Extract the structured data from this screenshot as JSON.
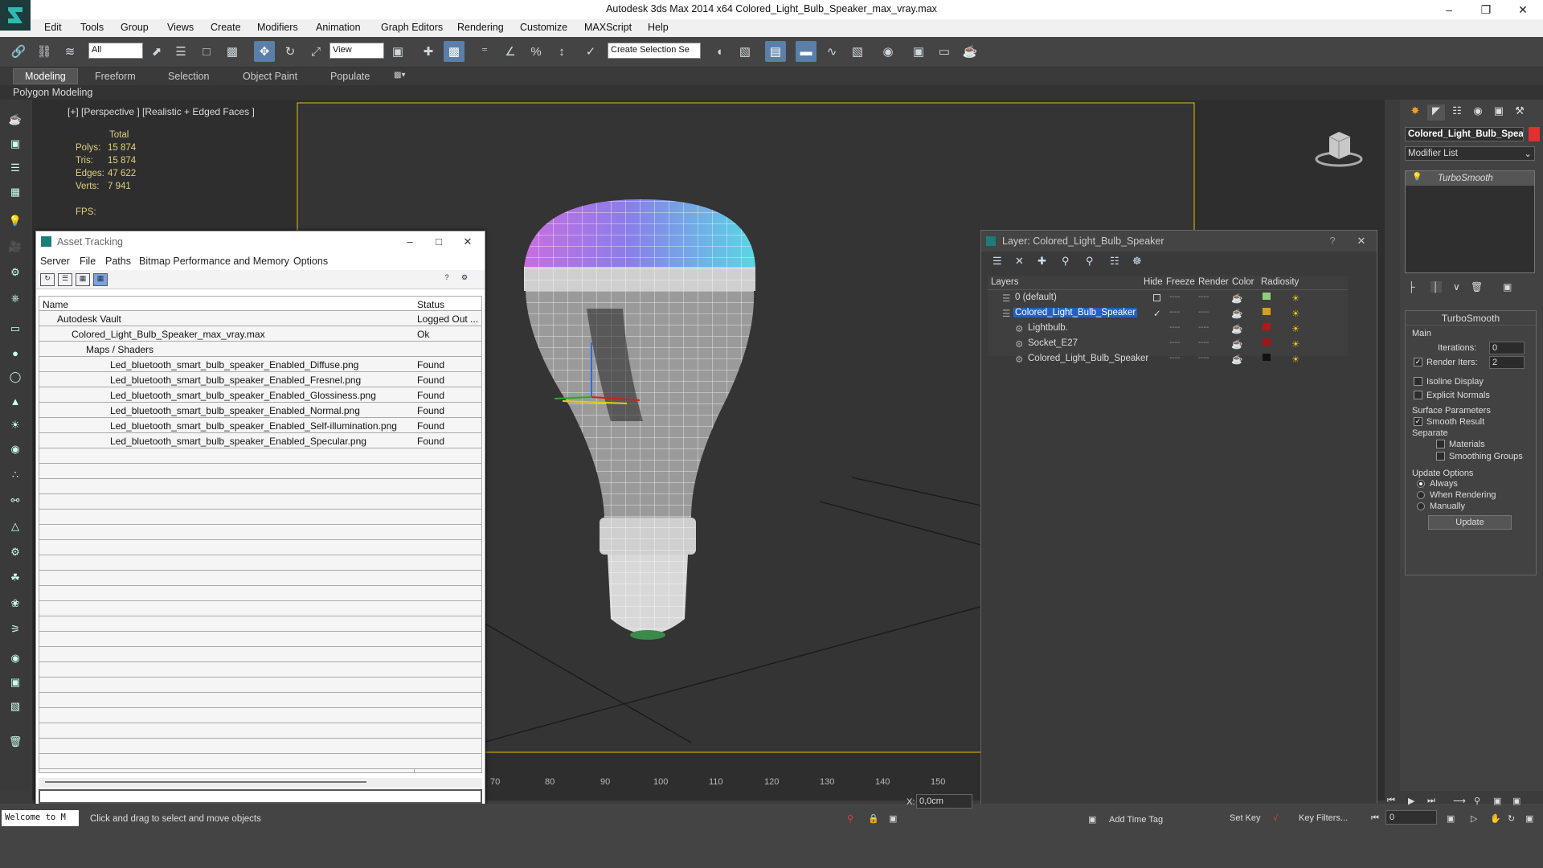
{
  "app": {
    "title": "Autodesk 3ds Max  2014 x64     Colored_Light_Bulb_Speaker_max_vray.max"
  },
  "menu": [
    "Edit",
    "Tools",
    "Group",
    "Views",
    "Create",
    "Modifiers",
    "Animation",
    "Graph Editors",
    "Rendering",
    "Customize",
    "MAXScript",
    "Help"
  ],
  "toolbar": {
    "selection_filter": "All",
    "ref_coord": "View",
    "named_selection": "Create Selection Se"
  },
  "ribbon": {
    "tabs": [
      "Modeling",
      "Freeform",
      "Selection",
      "Object Paint",
      "Populate"
    ],
    "panel": "Polygon Modeling"
  },
  "viewport": {
    "label": "[+] [Perspective ] [Realistic + Edged Faces ]",
    "stats": {
      "header": "Total",
      "polys_label": "Polys:",
      "polys": "15 874",
      "tris_label": "Tris:",
      "tris": "15 874",
      "edges_label": "Edges:",
      "edges": "47 622",
      "verts_label": "Verts:",
      "verts": "7 941",
      "fps_label": "FPS:"
    }
  },
  "asset_tracking": {
    "title": "Asset Tracking",
    "menu": [
      "Server",
      "File",
      "Paths",
      "Bitmap Performance and Memory",
      "Options"
    ],
    "columns": {
      "name": "Name",
      "status": "Status"
    },
    "rows": [
      {
        "name": "Autodesk Vault",
        "status": "Logged Out ...",
        "indent": 0
      },
      {
        "name": "Colored_Light_Bulb_Speaker_max_vray.max",
        "status": "Ok",
        "indent": 1
      },
      {
        "name": "Maps / Shaders",
        "status": "",
        "indent": 2
      },
      {
        "name": "Led_bluetooth_smart_bulb_speaker_Enabled_Diffuse.png",
        "status": "Found",
        "indent": 3
      },
      {
        "name": "Led_bluetooth_smart_bulb_speaker_Enabled_Fresnel.png",
        "status": "Found",
        "indent": 3
      },
      {
        "name": "Led_bluetooth_smart_bulb_speaker_Enabled_Glossiness.png",
        "status": "Found",
        "indent": 3
      },
      {
        "name": "Led_bluetooth_smart_bulb_speaker_Enabled_Normal.png",
        "status": "Found",
        "indent": 3
      },
      {
        "name": "Led_bluetooth_smart_bulb_speaker_Enabled_Self-illumination.png",
        "status": "Found",
        "indent": 3
      },
      {
        "name": "Led_bluetooth_smart_bulb_speaker_Enabled_Specular.png",
        "status": "Found",
        "indent": 3
      }
    ]
  },
  "layer_manager": {
    "title": "Layer: Colored_Light_Bulb_Speaker",
    "help": "?",
    "columns": {
      "layers": "Layers",
      "hide": "Hide",
      "freeze": "Freeze",
      "render": "Render",
      "color": "Color",
      "radiosity": "Radiosity"
    },
    "rows": [
      {
        "name": "0 (default)",
        "color": "#8fd07a",
        "selected": false
      },
      {
        "name": "Colored_Light_Bulb_Speaker",
        "color": "#d4a11e",
        "selected": true
      },
      {
        "name": "Lightbulb.",
        "color": "#b01818",
        "selected": false
      },
      {
        "name": "Socket_E27",
        "color": "#a01515",
        "selected": false
      },
      {
        "name": "Colored_Light_Bulb_Speaker",
        "color": "#111111",
        "selected": false
      }
    ]
  },
  "command_panel": {
    "object_name": "Colored_Light_Bulb_Spea",
    "modifier_list": "Modifier List",
    "stack_item": "TurboSmooth",
    "turbosmooth": {
      "title": "TurboSmooth",
      "main": "Main",
      "iterations_label": "Iterations:",
      "iterations": "0",
      "render_iters_label": "Render Iters:",
      "render_iters": "2",
      "isoline": "Isoline Display",
      "explicit_normals": "Explicit Normals",
      "surface_params": "Surface Parameters",
      "smooth_result": "Smooth Result",
      "separate": "Separate",
      "materials": "Materials",
      "smoothing_groups": "Smoothing Groups",
      "update_options": "Update Options",
      "always": "Always",
      "when_rendering": "When Rendering",
      "manually": "Manually",
      "update_button": "Update"
    }
  },
  "timeline": {
    "ticks": [
      "70",
      "80",
      "90",
      "100",
      "110",
      "120",
      "130",
      "140",
      "150"
    ]
  },
  "status": {
    "welcome": "Welcome to M",
    "hint": "Click and drag to select and move objects",
    "x_label": "X:",
    "x_value": "0,0cm",
    "add_time_tag": "Add Time Tag",
    "set_key": "Set Key",
    "key_filters": "Key Filters...",
    "frame": "0"
  }
}
